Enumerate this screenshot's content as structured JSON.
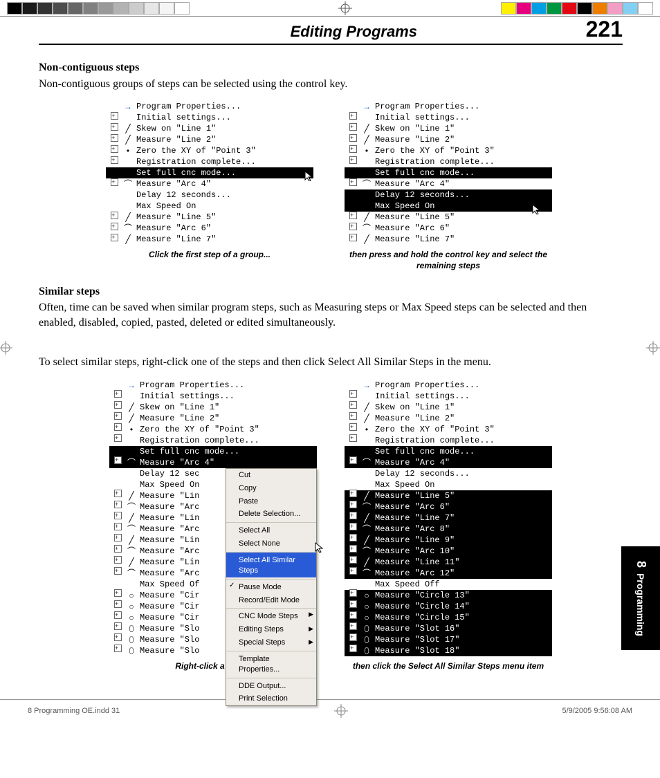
{
  "header": {
    "title": "Editing Programs",
    "page": "221"
  },
  "section1": {
    "heading": "Non-contiguous steps",
    "text": "Non-contiguous groups of steps can be selected using the control key."
  },
  "fig1_left_items": [
    {
      "exp": "",
      "ico": "→",
      "txt": "Program Properties...",
      "sel": false,
      "icoClass": "arrow-ico"
    },
    {
      "exp": "+",
      "ico": "",
      "txt": "Initial settings...",
      "sel": false
    },
    {
      "exp": "+",
      "ico": "╱",
      "txt": "Skew on \"Line 1\"",
      "sel": false
    },
    {
      "exp": "+",
      "ico": "╱",
      "txt": "Measure \"Line 2\"",
      "sel": false
    },
    {
      "exp": "+",
      "ico": "•",
      "txt": "Zero the XY of \"Point 3\"",
      "sel": false
    },
    {
      "exp": "+",
      "ico": "",
      "txt": "Registration complete...",
      "sel": false
    },
    {
      "exp": "",
      "ico": "",
      "txt": "Set full cnc mode...",
      "sel": true
    },
    {
      "exp": "+",
      "ico": "⌒",
      "txt": "Measure \"Arc 4\"",
      "sel": false
    },
    {
      "exp": "",
      "ico": "",
      "txt": "Delay 12 seconds...",
      "sel": false
    },
    {
      "exp": "",
      "ico": "",
      "txt": "Max Speed On",
      "sel": false
    },
    {
      "exp": "+",
      "ico": "╱",
      "txt": "Measure \"Line 5\"",
      "sel": false
    },
    {
      "exp": "+",
      "ico": "⌒",
      "txt": "Measure \"Arc 6\"",
      "sel": false
    },
    {
      "exp": "+",
      "ico": "╱",
      "txt": "Measure \"Line 7\"",
      "sel": false
    }
  ],
  "fig1_left_caption": "Click the first step of a group...",
  "fig1_right_items": [
    {
      "exp": "",
      "ico": "→",
      "txt": "Program Properties...",
      "sel": false,
      "icoClass": "arrow-ico"
    },
    {
      "exp": "+",
      "ico": "",
      "txt": "Initial settings...",
      "sel": false
    },
    {
      "exp": "+",
      "ico": "╱",
      "txt": "Skew on \"Line 1\"",
      "sel": false
    },
    {
      "exp": "+",
      "ico": "╱",
      "txt": "Measure \"Line 2\"",
      "sel": false
    },
    {
      "exp": "+",
      "ico": "•",
      "txt": "Zero the XY of \"Point 3\"",
      "sel": false
    },
    {
      "exp": "+",
      "ico": "",
      "txt": "Registration complete...",
      "sel": false
    },
    {
      "exp": "",
      "ico": "",
      "txt": "Set full cnc mode...",
      "sel": true
    },
    {
      "exp": "+",
      "ico": "⌒",
      "txt": "Measure \"Arc 4\"",
      "sel": false
    },
    {
      "exp": "",
      "ico": "",
      "txt": "Delay 12 seconds...",
      "sel": true
    },
    {
      "exp": "",
      "ico": "",
      "txt": "Max Speed On",
      "sel": true
    },
    {
      "exp": "+",
      "ico": "╱",
      "txt": "Measure \"Line 5\"",
      "sel": false
    },
    {
      "exp": "+",
      "ico": "⌒",
      "txt": "Measure \"Arc 6\"",
      "sel": false
    },
    {
      "exp": "+",
      "ico": "╱",
      "txt": "Measure \"Line 7\"",
      "sel": false
    }
  ],
  "fig1_right_caption": "then press and hold the control key and select the remaining steps",
  "section2": {
    "heading": "Similar steps",
    "text1": "Often, time can be saved when similar program steps, such as Measuring steps or Max Speed steps can be selected and then enabled, disabled, copied, pasted, deleted or edited simultaneously.",
    "text2": "To select similar steps, right-click one of the steps and then click Select All Similar Steps in the menu."
  },
  "fig2_left_items": [
    {
      "exp": "",
      "ico": "→",
      "txt": "Program Properties...",
      "sel": false,
      "icoClass": "arrow-ico"
    },
    {
      "exp": "+",
      "ico": "",
      "txt": "Initial settings...",
      "sel": false
    },
    {
      "exp": "+",
      "ico": "╱",
      "txt": "Skew on \"Line 1\"",
      "sel": false
    },
    {
      "exp": "+",
      "ico": "╱",
      "txt": "Measure \"Line 2\"",
      "sel": false
    },
    {
      "exp": "+",
      "ico": "•",
      "txt": "Zero the XY of \"Point 3\"",
      "sel": false
    },
    {
      "exp": "+",
      "ico": "",
      "txt": "Registration complete...",
      "sel": false
    },
    {
      "exp": "",
      "ico": "",
      "txt": "Set full cnc mode...",
      "sel": true
    },
    {
      "exp": "+",
      "ico": "⌒",
      "txt": "Measure \"Arc 4\"",
      "sel": true
    },
    {
      "exp": "",
      "ico": "",
      "txt": "Delay 12 sec",
      "sel": false
    },
    {
      "exp": "",
      "ico": "",
      "txt": "Max Speed On",
      "sel": false
    },
    {
      "exp": "+",
      "ico": "╱",
      "txt": "Measure \"Lin",
      "sel": false
    },
    {
      "exp": "+",
      "ico": "⌒",
      "txt": "Measure \"Arc",
      "sel": false
    },
    {
      "exp": "+",
      "ico": "╱",
      "txt": "Measure \"Lin",
      "sel": false
    },
    {
      "exp": "+",
      "ico": "⌒",
      "txt": "Measure \"Arc",
      "sel": false
    },
    {
      "exp": "+",
      "ico": "╱",
      "txt": "Measure \"Lin",
      "sel": false
    },
    {
      "exp": "+",
      "ico": "⌒",
      "txt": "Measure \"Arc",
      "sel": false
    },
    {
      "exp": "+",
      "ico": "╱",
      "txt": "Measure \"Lin",
      "sel": false
    },
    {
      "exp": "+",
      "ico": "⌒",
      "txt": "Measure \"Arc",
      "sel": false
    },
    {
      "exp": "",
      "ico": "",
      "txt": "Max Speed Of",
      "sel": false
    },
    {
      "exp": "+",
      "ico": "○",
      "txt": "Measure \"Cir",
      "sel": false
    },
    {
      "exp": "+",
      "ico": "○",
      "txt": "Measure \"Cir",
      "sel": false
    },
    {
      "exp": "+",
      "ico": "○",
      "txt": "Measure \"Cir",
      "sel": false
    },
    {
      "exp": "+",
      "ico": "⬯",
      "txt": "Measure \"Slo",
      "sel": false
    },
    {
      "exp": "+",
      "ico": "⬯",
      "txt": "Measure \"Slo",
      "sel": false
    },
    {
      "exp": "+",
      "ico": "⬯",
      "txt": "Measure \"Slo",
      "sel": false
    }
  ],
  "fig2_left_caption": "Right-click a step...",
  "context_menu": [
    {
      "label": "Cut",
      "sep": false
    },
    {
      "label": "Copy",
      "sep": false
    },
    {
      "label": "Paste",
      "sep": false
    },
    {
      "label": "Delete Selection...",
      "sep": false
    },
    {
      "label": "Select All",
      "sep": true
    },
    {
      "label": "Select None",
      "sep": false
    },
    {
      "label": "Select All Similar Steps",
      "sep": true,
      "hl": true
    },
    {
      "label": "Pause Mode",
      "sep": true,
      "chk": true
    },
    {
      "label": "Record/Edit Mode",
      "sep": false
    },
    {
      "label": "CNC Mode Steps",
      "sep": true,
      "arr": true
    },
    {
      "label": "Editing Steps",
      "sep": false,
      "arr": true
    },
    {
      "label": "Special Steps",
      "sep": false,
      "arr": true
    },
    {
      "label": "Template Properties...",
      "sep": true
    },
    {
      "label": "DDE Output...",
      "sep": true
    },
    {
      "label": "Print Selection",
      "sep": false
    }
  ],
  "fig2_right_items": [
    {
      "exp": "",
      "ico": "→",
      "txt": "Program Properties...",
      "sel": false,
      "icoClass": "arrow-ico"
    },
    {
      "exp": "+",
      "ico": "",
      "txt": "Initial settings...",
      "sel": false
    },
    {
      "exp": "+",
      "ico": "╱",
      "txt": "Skew on \"Line 1\"",
      "sel": false
    },
    {
      "exp": "+",
      "ico": "╱",
      "txt": "Measure \"Line 2\"",
      "sel": false
    },
    {
      "exp": "+",
      "ico": "•",
      "txt": "Zero the XY of \"Point 3\"",
      "sel": false
    },
    {
      "exp": "+",
      "ico": "",
      "txt": "Registration complete...",
      "sel": false
    },
    {
      "exp": "",
      "ico": "",
      "txt": "Set full cnc mode...",
      "sel": true
    },
    {
      "exp": "+",
      "ico": "⌒",
      "txt": "Measure \"Arc 4\"",
      "sel": true
    },
    {
      "exp": "",
      "ico": "",
      "txt": "Delay 12 seconds...",
      "sel": false
    },
    {
      "exp": "",
      "ico": "",
      "txt": "Max Speed On",
      "sel": false
    },
    {
      "exp": "+",
      "ico": "╱",
      "txt": "Measure \"Line 5\"",
      "sel": true
    },
    {
      "exp": "+",
      "ico": "⌒",
      "txt": "Measure \"Arc 6\"",
      "sel": true
    },
    {
      "exp": "+",
      "ico": "╱",
      "txt": "Measure \"Line 7\"",
      "sel": true
    },
    {
      "exp": "+",
      "ico": "⌒",
      "txt": "Measure \"Arc 8\"",
      "sel": true
    },
    {
      "exp": "+",
      "ico": "╱",
      "txt": "Measure \"Line 9\"",
      "sel": true
    },
    {
      "exp": "+",
      "ico": "⌒",
      "txt": "Measure \"Arc 10\"",
      "sel": true
    },
    {
      "exp": "+",
      "ico": "╱",
      "txt": "Measure \"Line 11\"",
      "sel": true
    },
    {
      "exp": "+",
      "ico": "⌒",
      "txt": "Measure \"Arc 12\"",
      "sel": true
    },
    {
      "exp": "",
      "ico": "",
      "txt": "Max Speed Off",
      "sel": false
    },
    {
      "exp": "+",
      "ico": "○",
      "txt": "Measure \"Circle 13\"",
      "sel": true
    },
    {
      "exp": "+",
      "ico": "○",
      "txt": "Measure \"Circle 14\"",
      "sel": true
    },
    {
      "exp": "+",
      "ico": "○",
      "txt": "Measure \"Circle 15\"",
      "sel": true
    },
    {
      "exp": "+",
      "ico": "⬯",
      "txt": "Measure \"Slot 16\"",
      "sel": true
    },
    {
      "exp": "+",
      "ico": "⬯",
      "txt": "Measure \"Slot 17\"",
      "sel": true
    },
    {
      "exp": "+",
      "ico": "⬯",
      "txt": "Measure \"Slot 18\"",
      "sel": true
    }
  ],
  "fig2_right_caption": "then click the Select All Similar Steps menu item",
  "sidetab": {
    "num": "8",
    "label": "Programming"
  },
  "footer": {
    "file": "8 Programming OE.indd   31",
    "date": "5/9/2005   9:56:08 AM"
  },
  "colorbar_left": [
    "#000",
    "#1a1a1a",
    "#333",
    "#4d4d4d",
    "#666",
    "#808080",
    "#999",
    "#b3b3b3",
    "#ccc",
    "#e6e6e6",
    "#f5f5f5",
    "#fff"
  ],
  "colorbar_right": [
    "#ffef00",
    "#e6007e",
    "#009fe3",
    "#009640",
    "#e30613",
    "#000",
    "#ef7d00",
    "#f29ec4",
    "#83d0f5",
    "#fff"
  ]
}
